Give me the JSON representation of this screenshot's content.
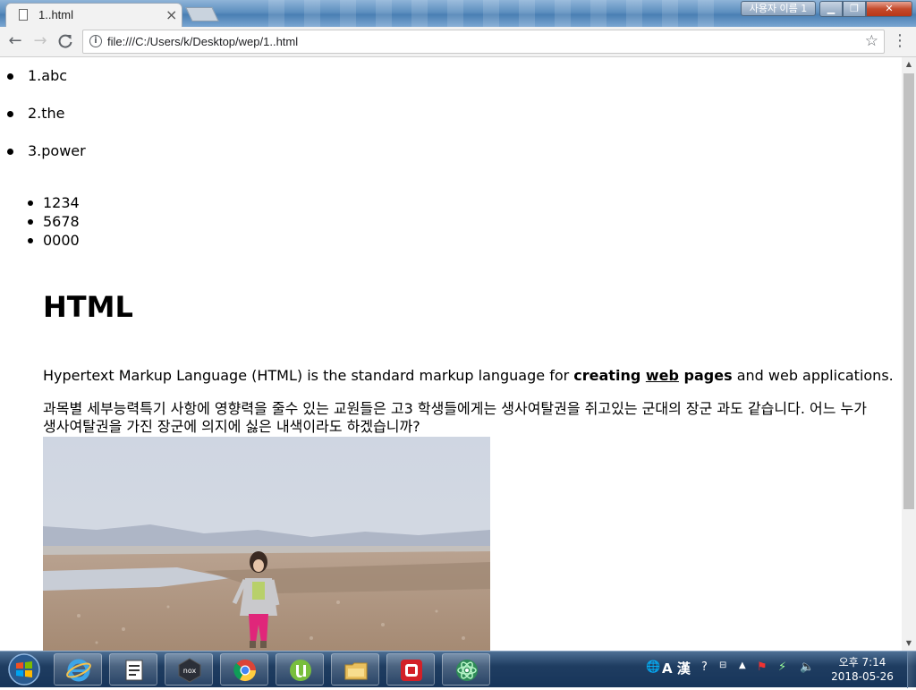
{
  "browser": {
    "tab_title": "1..html",
    "tab_close": "×",
    "user_button": "사용자 이름 1",
    "url": "file:///C:/Users/k/Desktop/wep/1..html",
    "icons": [
      "back-arrow-icon",
      "forward-arrow-icon",
      "reload-icon",
      "info-icon",
      "star-icon",
      "menu-dots-icon"
    ]
  },
  "page": {
    "list1": [
      "1.abc",
      "2.the",
      "3.power"
    ],
    "list2": [
      "1234",
      "5678",
      "0000"
    ],
    "heading": "HTML",
    "paragraph": {
      "before": "Hypertext Markup Language (HTML) is the standard markup language for ",
      "bold1": "creating ",
      "link": "web",
      "bold2": " pages",
      "after": " and web applications."
    },
    "korean_text": "과목별 세부능력특기 사항에 영향력을 줄수 있는 교원들은 고3 학생들에게는 생사여탈권을 쥐고있는 군대의 장군 과도 같습니다. 어느 누가 생사여탈권을 가진 장군에 의지에 싫은 내색이라도 하겠습니까?"
  },
  "taskbar": {
    "apps": [
      "internet-explorer",
      "notepad",
      "nox",
      "chrome",
      "utorrent",
      "file-explorer",
      "media-app",
      "atom"
    ],
    "tray_ime": "A 漢",
    "clock_time": "오후 7:14",
    "clock_date": "2018-05-26"
  }
}
